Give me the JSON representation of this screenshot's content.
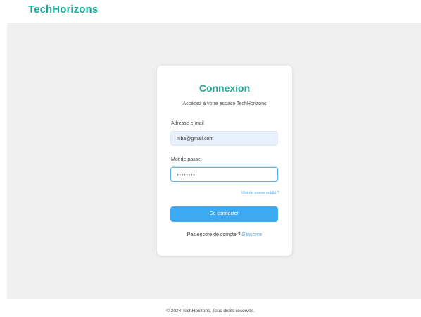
{
  "header": {
    "brand": "TechHorizons"
  },
  "login": {
    "title": "Connexion",
    "subtitle": "Accédez à votre espace TechHorizons",
    "email_label": "Adresse e-mail",
    "email_value": "hiba@gmail.com",
    "password_label": "Mot de passe",
    "password_value": "••••••••",
    "forgot_link": "Mot de passe oublié ?",
    "submit_label": "Se connecter",
    "signup_prompt": "Pas encore de compte ?",
    "signup_link": "S'inscrire"
  },
  "footer": {
    "text": "© 2024 TechHorizons. Tous droits réservés."
  },
  "colors": {
    "brand": "#1ba89a",
    "title": "#2aa79b",
    "primary_button": "#3da9f2",
    "link": "#4aa8e6",
    "email_field_bg": "#e8f0fb",
    "focus_border": "#56b3ea"
  }
}
